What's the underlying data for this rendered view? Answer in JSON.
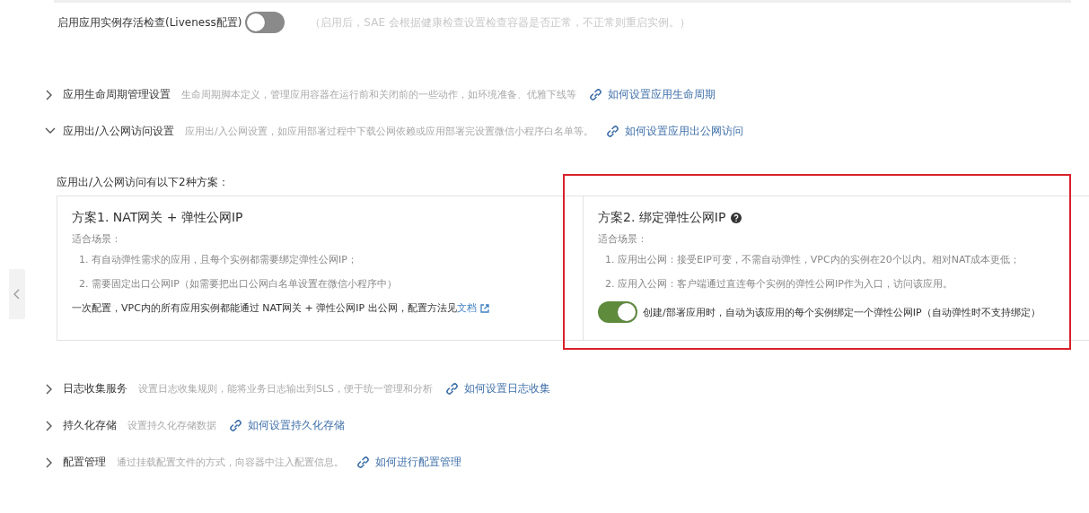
{
  "liveness": {
    "label": "启用应用实例存活检查(Liveness配置)",
    "on": false,
    "hint": "（启用后，SAE 会根据健康检查设置检查容器是否正常，不正常则重启实例。）"
  },
  "sections": [
    {
      "title": "应用生命周期管理设置",
      "description": "生命周期脚本定义，管理应用容器在运行前和关闭前的一些动作，如环境准备、优雅下线等",
      "link": "如何设置应用生命周期",
      "expanded": false
    },
    {
      "title": "应用出/入公网访问设置",
      "description": "应用出/入公网设置，如应用部署过程中下载公网依赖或应用部署完设置微信小程序白名单等。",
      "link": "如何设置应用出公网访问",
      "expanded": true,
      "panel": {
        "intro": "应用出/入公网访问有以下2种方案：",
        "plans": [
          {
            "kind": "note",
            "title": "方案1. NAT网关 + 弹性公网IP",
            "help": false,
            "highlighted": false,
            "scenario_label": "适合场景：",
            "items": [
              "1. 有自动弹性需求的应用，且每个实例都需要绑定弹性公网IP；",
              "2. 需要固定出口公网IP（如需要把出口公网白名单设置在微信小程序中）"
            ],
            "note": "一次配置，VPC内的所有应用实例都能通过 NAT网关 + 弹性公网IP 出公网，配置方法见",
            "note_link": "文档"
          },
          {
            "kind": "toggle",
            "title": "方案2. 绑定弹性公网IP",
            "help": true,
            "highlighted": true,
            "scenario_label": "适合场景：",
            "items": [
              "1. 应用出公网：接受EIP可变，不需自动弹性，VPC内的实例在20个以内。相对NAT成本更低；",
              "2. 应用入公网：客户端通过直连每个实例的弹性公网IP作为入口，访问该应用。"
            ],
            "toggle_label": "创建/部署应用时，自动为该应用的每个实例绑定一个弹性公网IP（自动弹性时不支持绑定）",
            "on": true
          }
        ]
      }
    },
    {
      "title": "日志收集服务",
      "description": "设置日志收集规则，能将业务日志输出到SLS，便于统一管理和分析",
      "link": "如何设置日志收集",
      "expanded": false
    },
    {
      "title": "持久化存储",
      "description": "设置持久化存储数据",
      "link": "如何设置持久化存储",
      "expanded": false
    },
    {
      "title": "配置管理",
      "description": "通过挂载配置文件的方式，向容器中注入配置信息。",
      "link": "如何进行配置管理",
      "expanded": false
    }
  ]
}
